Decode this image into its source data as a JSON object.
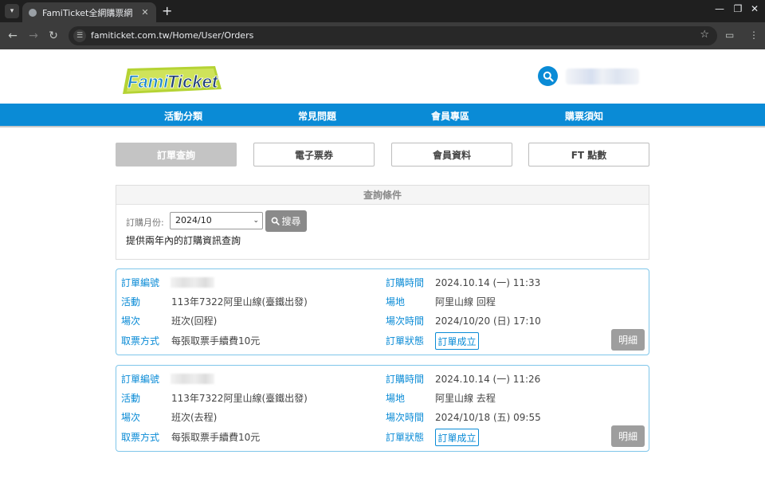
{
  "browser": {
    "tab_title": "FamiTicket全網購票網",
    "url": "famiticket.com.tw/Home/User/Orders"
  },
  "site": {
    "logo_text_1": "Fami",
    "logo_text_2": "Ticket",
    "nav": [
      "活動分類",
      "常見問題",
      "會員專區",
      "購票須知"
    ],
    "colors": {
      "brand_blue": "#0a8bd6",
      "logo_green": "#b5d334",
      "tab_gray": "#c4c4c4"
    }
  },
  "member_tabs": [
    {
      "label": "訂單查詢",
      "active": true
    },
    {
      "label": "電子票券",
      "active": false
    },
    {
      "label": "會員資料",
      "active": false
    },
    {
      "label": "FT 點數",
      "active": false
    }
  ],
  "query": {
    "title": "查詢條件",
    "month_label": "訂購月份:",
    "month_value": "2024/10",
    "search_label": "搜尋",
    "note": "提供兩年內的訂購資訊查詢"
  },
  "labels": {
    "order_no": "訂單編號",
    "event": "活動",
    "session": "場次",
    "pickup": "取票方式",
    "order_time": "訂購時間",
    "venue": "場地",
    "session_time": "場次時間",
    "status": "訂單狀態",
    "detail": "明細"
  },
  "orders": [
    {
      "order_time": "2024.10.14 (一) 11:33",
      "event": "113年7322阿里山線(臺鐵出發)",
      "venue": "阿里山線 回程",
      "session": "班次(回程)",
      "session_time": "2024/10/20 (日) 17:10",
      "pickup": "每張取票手續費10元",
      "status": "訂單成立"
    },
    {
      "order_time": "2024.10.14 (一) 11:26",
      "event": "113年7322阿里山線(臺鐵出發)",
      "venue": "阿里山線 去程",
      "session": "班次(去程)",
      "session_time": "2024/10/18 (五) 09:55",
      "pickup": "每張取票手續費10元",
      "status": "訂單成立"
    }
  ]
}
